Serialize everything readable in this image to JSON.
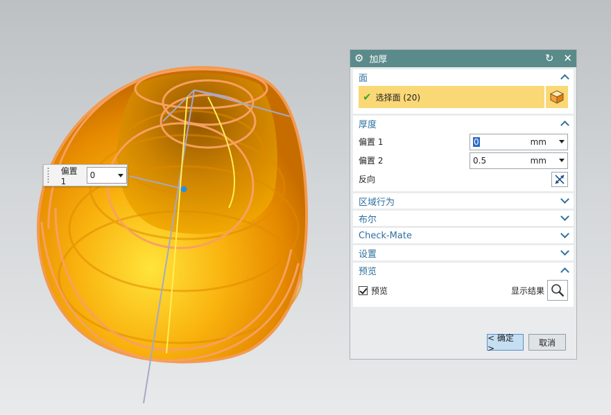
{
  "floating_input": {
    "label": "偏置 1",
    "value": "0"
  },
  "dialog": {
    "title": "加厚",
    "face": {
      "header": "面",
      "select_label": "选择面 (20)"
    },
    "thickness": {
      "header": "厚度",
      "offset1": {
        "label": "偏置 1",
        "value": "0",
        "unit": "mm"
      },
      "offset2": {
        "label": "偏置 2",
        "value": "0.5",
        "unit": "mm"
      },
      "reverse_label": "反向"
    },
    "region_header": "区域行为",
    "boolean_header": "布尔",
    "checkmate_header": "Check-Mate",
    "settings_header": "设置",
    "preview": {
      "header": "预览",
      "checkbox_label": "预览",
      "show_result_label": "显示结果"
    },
    "ok_label": "< 确定 >",
    "cancel_label": "取消"
  },
  "colors": {
    "titlebar": "#5b8a8b",
    "section_header_text": "#2d6f9e",
    "selection_highlight": "#fbd876",
    "model_orange": "#f5a000"
  },
  "icons": [
    "gear-icon",
    "reset-icon",
    "close-icon",
    "check-icon",
    "cube-icon",
    "reverse-icon",
    "magnifier-icon",
    "chevron-up-icon",
    "chevron-down-icon"
  ]
}
